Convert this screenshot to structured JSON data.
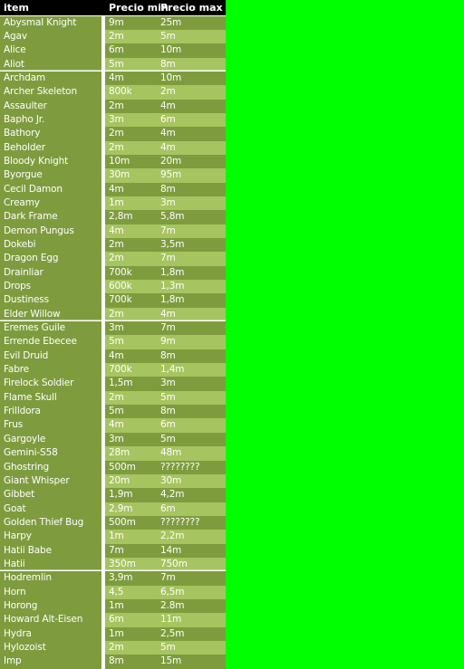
{
  "page": {
    "background_color": "#00ff00",
    "table_header_bg": "#000000",
    "row_color_dark": "#7e9c3e",
    "row_color_light": "#a6c45f",
    "text_color": "#ffffff"
  },
  "table": {
    "columns": [
      {
        "key": "item",
        "label": "item"
      },
      {
        "key": "min",
        "label": "Precio min"
      },
      {
        "key": "max",
        "label": "Precio max"
      }
    ],
    "rows": [
      {
        "item": "Abysmal Knight",
        "min": "9m",
        "max": "25m",
        "separator": false
      },
      {
        "item": "Agav",
        "min": "2m",
        "max": "5m",
        "separator": false
      },
      {
        "item": "Alice",
        "min": "6m",
        "max": "10m",
        "separator": false
      },
      {
        "item": "Aliot",
        "min": "5m",
        "max": "8m",
        "separator": true
      },
      {
        "item": "Archdam",
        "min": "4m",
        "max": "10m",
        "separator": false
      },
      {
        "item": "Archer Skeleton",
        "min": "800k",
        "max": "2m",
        "separator": false
      },
      {
        "item": "Assaulter",
        "min": "2m",
        "max": "4m",
        "separator": false
      },
      {
        "item": "Bapho Jr.",
        "min": "3m",
        "max": "6m",
        "separator": false
      },
      {
        "item": "Bathory",
        "min": "2m",
        "max": "4m",
        "separator": false
      },
      {
        "item": "Beholder",
        "min": "2m",
        "max": "4m",
        "separator": false
      },
      {
        "item": "Bloody Knight",
        "min": "10m",
        "max": "20m",
        "separator": false
      },
      {
        "item": "Byorgue",
        "min": "30m",
        "max": "95m",
        "separator": false
      },
      {
        "item": "Cecil Damon",
        "min": "4m",
        "max": "8m",
        "separator": false
      },
      {
        "item": "Creamy",
        "min": "1m",
        "max": "3m",
        "separator": false
      },
      {
        "item": "Dark Frame",
        "min": "2,8m",
        "max": "5,8m",
        "separator": false
      },
      {
        "item": "Demon Pungus",
        "min": "4m",
        "max": "7m",
        "separator": false
      },
      {
        "item": "Dokebi",
        "min": "2m",
        "max": "3,5m",
        "separator": false
      },
      {
        "item": "Dragon Egg",
        "min": "2m",
        "max": "7m",
        "separator": false
      },
      {
        "item": "Drainliar",
        "min": "700k",
        "max": "1,8m",
        "separator": false
      },
      {
        "item": "Drops",
        "min": "600k",
        "max": "1,3m",
        "separator": false
      },
      {
        "item": "Dustiness",
        "min": "700k",
        "max": "1,8m",
        "separator": false
      },
      {
        "item": "Elder Willow",
        "min": "2m",
        "max": "4m",
        "separator": true
      },
      {
        "item": "Eremes Guile",
        "min": "3m",
        "max": "7m",
        "separator": false
      },
      {
        "item": "Errende Ebecee",
        "min": "5m",
        "max": "9m",
        "separator": false
      },
      {
        "item": "Evil Druid",
        "min": "4m",
        "max": "8m",
        "separator": false
      },
      {
        "item": "Fabre",
        "min": "700k",
        "max": "1,4m",
        "separator": false
      },
      {
        "item": "Firelock Soldier",
        "min": "1,5m",
        "max": "3m",
        "separator": false
      },
      {
        "item": "Flame Skull",
        "min": "2m",
        "max": "5m",
        "separator": false
      },
      {
        "item": "Frilldora",
        "min": "5m",
        "max": "8m",
        "separator": false
      },
      {
        "item": "Frus",
        "min": "4m",
        "max": "6m",
        "separator": false
      },
      {
        "item": "Gargoyle",
        "min": "3m",
        "max": "5m",
        "separator": false
      },
      {
        "item": "Gemini-S58",
        "min": "28m",
        "max": "48m",
        "separator": false
      },
      {
        "item": "Ghostring",
        "min": "500m",
        "max": "????????",
        "separator": false
      },
      {
        "item": "Giant Whisper",
        "min": "20m",
        "max": "30m",
        "separator": false
      },
      {
        "item": "Gibbet",
        "min": "1,9m",
        "max": "4,2m",
        "separator": false
      },
      {
        "item": "Goat",
        "min": "2,9m",
        "max": "6m",
        "separator": false
      },
      {
        "item": "Golden Thief Bug",
        "min": "500m",
        "max": "????????",
        "separator": false
      },
      {
        "item": "Harpy",
        "min": "1m",
        "max": "2,2m",
        "separator": false
      },
      {
        "item": "Hatii Babe",
        "min": "7m",
        "max": "14m",
        "separator": false
      },
      {
        "item": "Hatii",
        "min": "350m",
        "max": "750m",
        "separator": true
      },
      {
        "item": "Hodremlin",
        "min": "3,9m",
        "max": "7m",
        "separator": false
      },
      {
        "item": "Horn",
        "min": "4,5",
        "max": "6,5m",
        "separator": false
      },
      {
        "item": "Horong",
        "min": "1m",
        "max": "2.8m",
        "separator": false
      },
      {
        "item": "Howard Alt-Eisen",
        "min": "6m",
        "max": "11m",
        "separator": false
      },
      {
        "item": "Hydra",
        "min": "1m",
        "max": "2,5m",
        "separator": false
      },
      {
        "item": "Hylozoist",
        "min": "2m",
        "max": "5m",
        "separator": false
      },
      {
        "item": "Imp",
        "min": "8m",
        "max": "15m",
        "separator": false
      }
    ]
  }
}
